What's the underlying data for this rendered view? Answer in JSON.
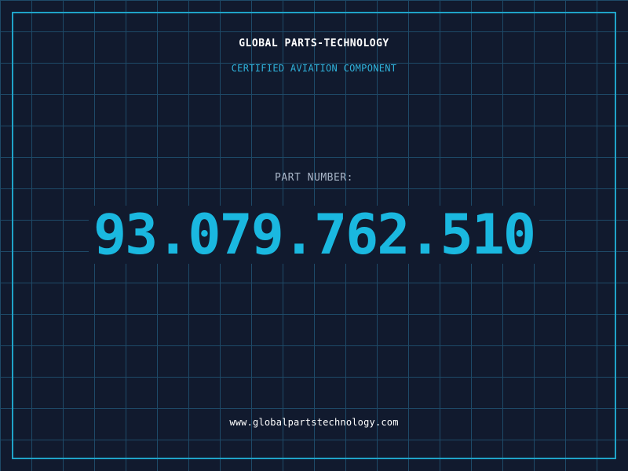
{
  "card": {
    "brand": "GLOBAL PARTS-TECHNOLOGY",
    "subtitle": "CERTIFIED AVIATION COMPONENT",
    "part_label": "PART NUMBER:",
    "part_number": "93.079.762.510",
    "website": "www.globalpartstechnology.com"
  },
  "colors": {
    "background": "#111a2e",
    "grid": "#1e4a68",
    "frame": "#1fa3c8",
    "accent": "#1ab8e0",
    "subtitle": "#2fb3dc",
    "label": "#a9b6c8",
    "text": "#ffffff"
  }
}
